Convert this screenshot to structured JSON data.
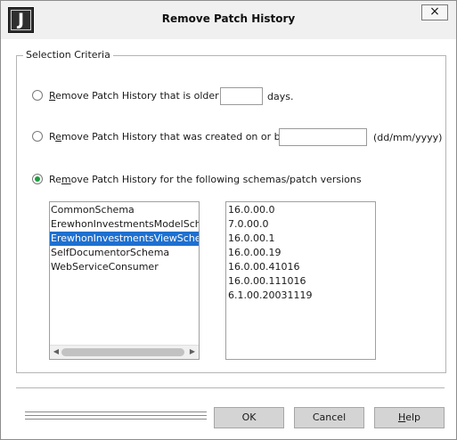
{
  "window": {
    "title": "Remove Patch History",
    "logo_letter": "J",
    "close_label": "×"
  },
  "selection_criteria": {
    "label": "Selection Criteria",
    "option_older": {
      "accel": "R",
      "label": "emove Patch History that is older than",
      "value": "",
      "suffix": "days."
    },
    "option_created": {
      "label_prefix": "R",
      "accel": "e",
      "label": "move Patch History that was created on or before",
      "value": "",
      "suffix": "(dd/mm/yyyy)"
    },
    "option_schemas": {
      "label_prefix": "Re",
      "accel": "m",
      "label": "ove Patch History for the following schemas/patch versions",
      "checked": true
    },
    "schemas": [
      "CommonSchema",
      "ErewhonInvestmentsModelSchema",
      "ErewhonInvestmentsViewSchema",
      "SelfDocumentorSchema",
      "WebServiceConsumer"
    ],
    "selected_schema_index": 2,
    "versions": [
      "16.0.00.0",
      "7.0.00.0",
      "16.0.00.1",
      "16.0.00.19",
      "16.0.00.41016",
      "16.0.00.111016",
      "6.1.00.20031119"
    ]
  },
  "buttons": {
    "ok": "OK",
    "cancel": "Cancel",
    "help_accel": "H",
    "help": "elp"
  },
  "icons": {
    "scroll_left": "◀",
    "scroll_right": "▶"
  }
}
